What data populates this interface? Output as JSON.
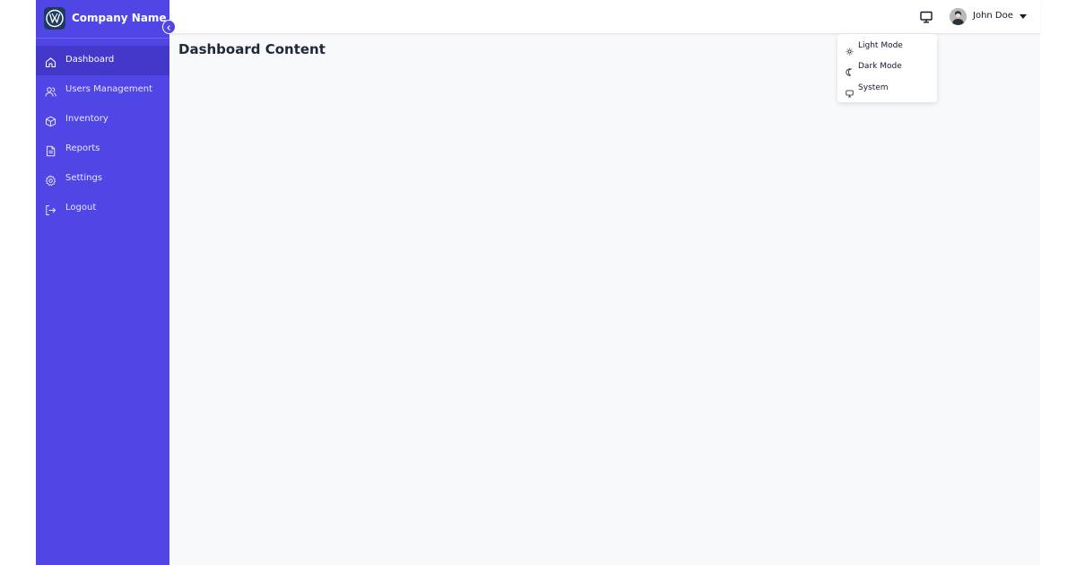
{
  "brand": {
    "name": "Company Name",
    "logo_icon": "vw-logo-icon",
    "accent_color": "#5045e5"
  },
  "sidebar": {
    "items": [
      {
        "label": "Dashboard",
        "icon": "home-icon",
        "active": true
      },
      {
        "label": "Users Management",
        "icon": "users-icon",
        "active": false
      },
      {
        "label": "Inventory",
        "icon": "box-icon",
        "active": false
      },
      {
        "label": "Reports",
        "icon": "document-icon",
        "active": false
      },
      {
        "label": "Settings",
        "icon": "gear-icon",
        "active": false
      },
      {
        "label": "Logout",
        "icon": "logout-icon",
        "active": false
      }
    ],
    "collapse_icon": "chevron-left-icon"
  },
  "header": {
    "theme_icon": "monitor-icon",
    "user": {
      "name": "John Doe",
      "avatar_icon": "avatar",
      "menu_icon": "caret-down-icon"
    }
  },
  "main": {
    "title": "Dashboard Content"
  },
  "theme_menu": {
    "items": [
      {
        "label": "Light Mode",
        "icon": "sun-icon"
      },
      {
        "label": "Dark Mode",
        "icon": "moon-icon"
      },
      {
        "label": "System",
        "icon": "monitor-icon"
      }
    ]
  }
}
